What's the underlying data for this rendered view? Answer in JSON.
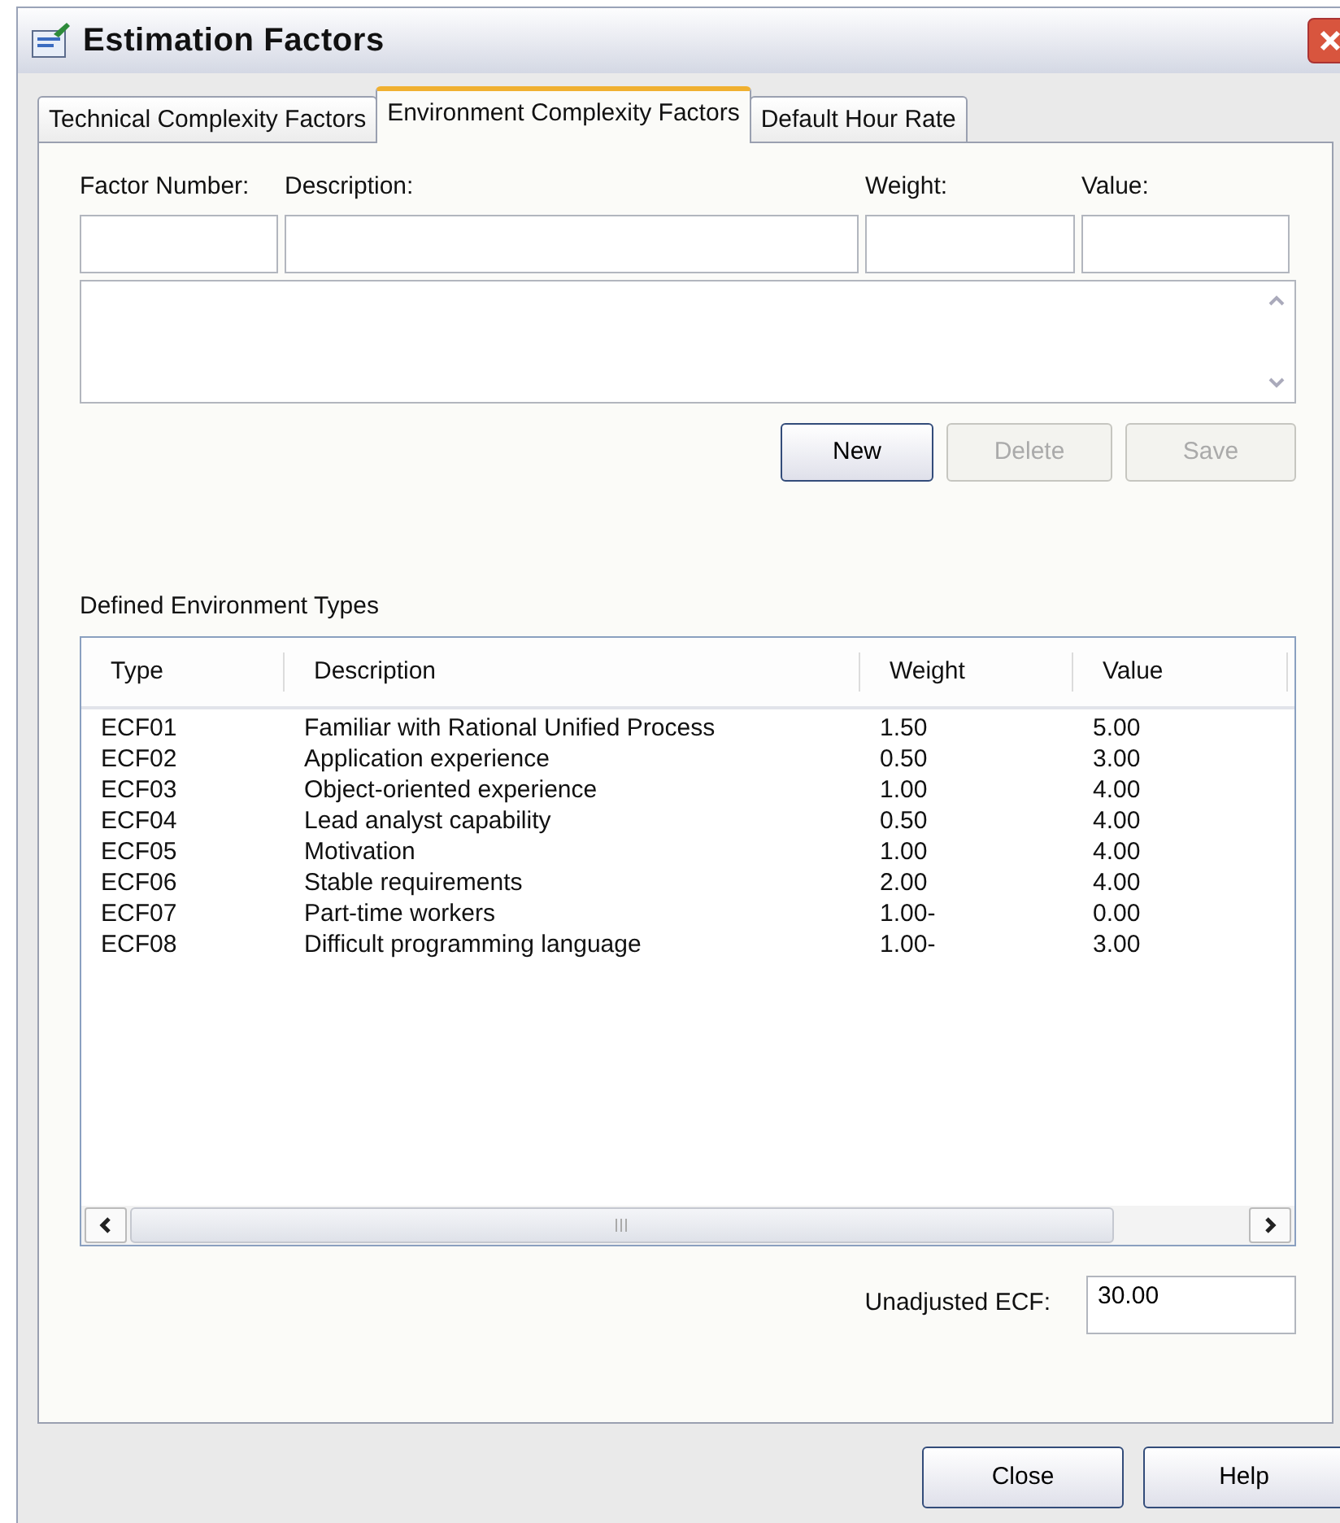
{
  "window": {
    "title": "Estimation Factors"
  },
  "tabs": [
    {
      "label": "Technical Complexity Factors",
      "selected": false
    },
    {
      "label": "Environment Complexity Factors",
      "selected": true
    },
    {
      "label": "Default Hour Rate",
      "selected": false
    }
  ],
  "form": {
    "labels": [
      "Factor Number:",
      "Description:",
      "Weight:",
      "Value:"
    ]
  },
  "form_buttons": [
    {
      "label": "New",
      "disabled": false
    },
    {
      "label": "Delete",
      "disabled": true
    },
    {
      "label": "Save",
      "disabled": true
    }
  ],
  "table": {
    "title": "Defined Environment Types",
    "columns": [
      "Type",
      "Description",
      "Weight",
      "Value"
    ],
    "rows": [
      [
        "ECF01",
        "Familiar with Rational Unified Process",
        "1.50",
        "5.00"
      ],
      [
        "ECF02",
        "Application experience",
        "0.50",
        "3.00"
      ],
      [
        "ECF03",
        "Object-oriented experience",
        "1.00",
        "4.00"
      ],
      [
        "ECF04",
        "Lead analyst capability",
        "0.50",
        "4.00"
      ],
      [
        "ECF05",
        "Motivation",
        "1.00",
        "4.00"
      ],
      [
        "ECF06",
        "Stable requirements",
        "2.00",
        "4.00"
      ],
      [
        "ECF07",
        "Part-time workers",
        "1.00-",
        "0.00"
      ],
      [
        "ECF08",
        "Difficult programming language",
        "1.00-",
        "3.00"
      ]
    ]
  },
  "total": {
    "label": "Unadjusted ECF:",
    "value": "30.00"
  },
  "buttons": [
    "Close",
    "Help"
  ]
}
